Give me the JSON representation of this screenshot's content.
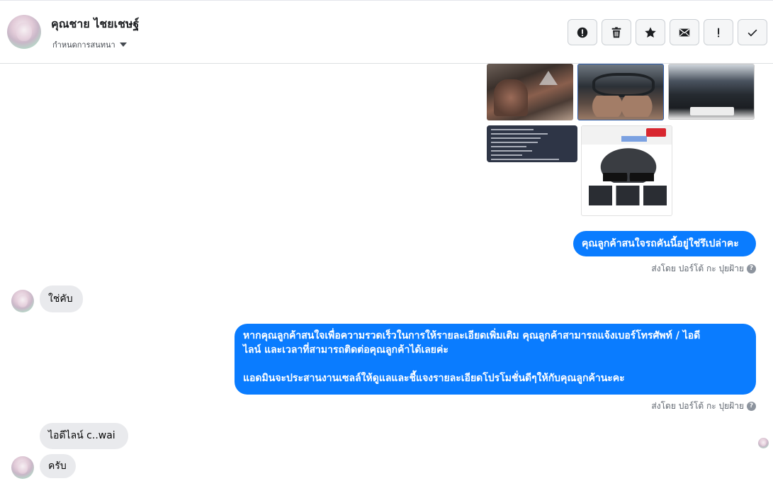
{
  "header": {
    "contact_name": "คุณชาย ไชยเชษฐ์",
    "conversation_settings": "กำหนดการสนทนา",
    "avatar_icon": "user-avatar",
    "toolbar": [
      {
        "name": "report-button",
        "icon": "alert-circle-icon"
      },
      {
        "name": "delete-button",
        "icon": "trash-icon"
      },
      {
        "name": "star-button",
        "icon": "star-icon"
      },
      {
        "name": "mark-unread-button",
        "icon": "envelope-icon"
      },
      {
        "name": "important-button",
        "icon": "exclamation-icon"
      },
      {
        "name": "done-button",
        "icon": "check-icon"
      }
    ]
  },
  "attachments": [
    {
      "name": "car-interior-photo-1"
    },
    {
      "name": "car-interior-photo-2"
    },
    {
      "name": "car-engine-photo"
    },
    {
      "name": "car-spec-card"
    },
    {
      "name": "car-ad-card"
    }
  ],
  "messages": {
    "out1": "คุณลูกค้าสนใจรถคันนี้อยู่ใช่รึเปล่าคะ",
    "in1": "ใช่คับ",
    "out2_line1": "หากคุณลูกค้าสนใจเพื่อความรวดเร็วในการให้รายละเอียดเพิ่มเติม คุณลูกค้าสามารถแจ้งเบอร์โทรศัพท์ / ไอดี",
    "out2_line2": "ไลน์ และเวลาที่สามารถติดต่อคุณลูกค้าได้เลยค่ะ",
    "out2_line3": "แอดมินจะประสานงานเซลล์ให้ดูแลและชี้แจงรายละเอียดโปรโมชั่นดีๆให้กับคุณลูกค้านะคะ",
    "in2": "ไอดีไลน์ c..wai",
    "in3": "ครับ"
  },
  "sent_by": "ส่งโดย ปอร์โต้ กะ ปุยฝ้าย",
  "help_glyph": "?",
  "colors": {
    "outgoing_bubble": "#0a7cff",
    "incoming_bubble": "#e9eaed"
  }
}
